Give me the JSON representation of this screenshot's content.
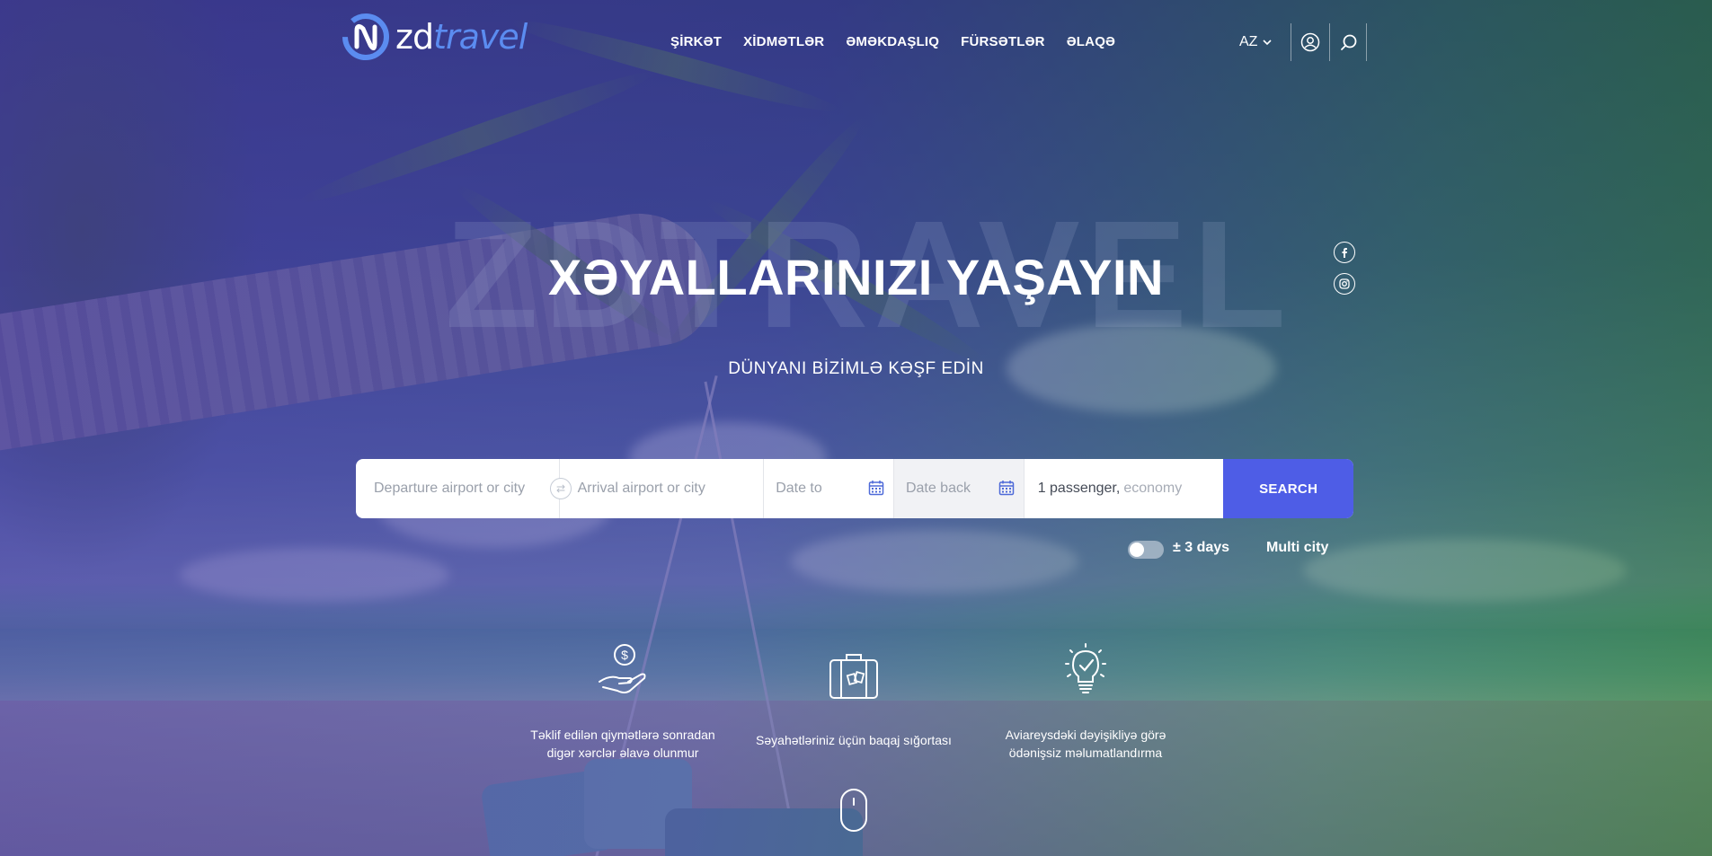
{
  "logo": {
    "brand_part1": "zd",
    "brand_part2": "travel"
  },
  "nav": [
    "ŞİRKƏT",
    "XİDMƏTLƏR",
    "ƏMƏKDAŞLIQ",
    "FÜRSƏTLƏR",
    "ƏLAQƏ"
  ],
  "header": {
    "language": "AZ"
  },
  "hero": {
    "watermark": "ZDTRAVEL",
    "title": "XƏYALLARINIZI YAŞAYIN",
    "subtitle": "DÜNYANI BİZİMLƏ KƏŞF EDİN"
  },
  "social": [
    "facebook-icon",
    "instagram-icon"
  ],
  "search": {
    "from_placeholder": "Departure airport or city",
    "to_placeholder": "Arrival airport or city",
    "date_to_placeholder": "Date to",
    "date_back_placeholder": "Date back",
    "passengers": "1 passenger,",
    "cabin_class": "economy",
    "button": "SEARCH"
  },
  "options": {
    "flex_days": "± 3 days",
    "flex_days_enabled": false,
    "multi_city": "Multi city"
  },
  "features": [
    {
      "icon": "money-hand-icon",
      "text_line1": "Təklif edilən qiymətlərə sonradan",
      "text_line2": "digər xərclər əlavə olunmur"
    },
    {
      "icon": "luggage-icon",
      "text_line1": "Səyahətləriniz üçün baqaj sığortası",
      "text_line2": ""
    },
    {
      "icon": "lightbulb-check-icon",
      "text_line1": "Aviareysdəki dəyişikliyə görə",
      "text_line2": "ödənişsiz məlumatlandırma"
    }
  ],
  "colors": {
    "accent": "#4e5de6",
    "logo_accent": "#5b8cf0"
  }
}
